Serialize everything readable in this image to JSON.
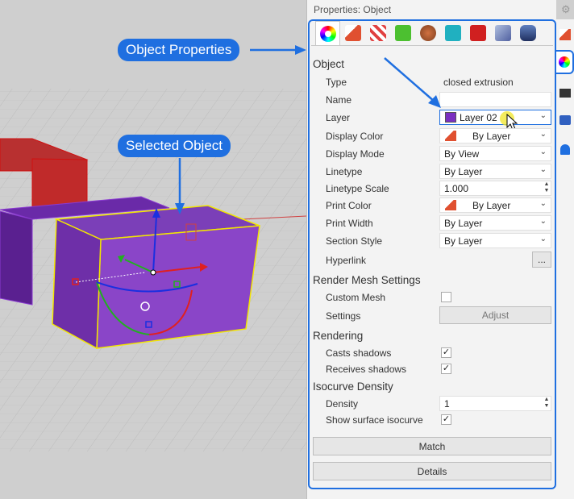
{
  "callouts": {
    "object_properties": "Object Properties",
    "selected_object": "Selected Object"
  },
  "panel": {
    "title": "Properties: Object",
    "tabs": [
      "object-color-wheel-icon",
      "material-brush-icon",
      "decal-icon",
      "texture-mapping-icon",
      "render-mesh-icon",
      "edge-softening-icon",
      "shut-lining-icon",
      "displacement-icon",
      "thickness-icon"
    ],
    "object_section": "Object",
    "type_label": "Type",
    "type_value": "closed extrusion",
    "name_label": "Name",
    "name_value": "",
    "layer_label": "Layer",
    "layer_value": "Layer 02",
    "layer_color": "#7a2fc1",
    "display_color_label": "Display Color",
    "display_color_value": "By Layer",
    "display_mode_label": "Display Mode",
    "display_mode_value": "By View",
    "linetype_label": "Linetype",
    "linetype_value": "By Layer",
    "linetype_scale_label": "Linetype Scale",
    "linetype_scale_value": "1.000",
    "print_color_label": "Print Color",
    "print_color_value": "By Layer",
    "print_width_label": "Print Width",
    "print_width_value": "By Layer",
    "section_style_label": "Section Style",
    "section_style_value": "By Layer",
    "hyperlink_label": "Hyperlink",
    "hyperlink_button": "...",
    "render_mesh_section": "Render Mesh Settings",
    "custom_mesh_label": "Custom Mesh",
    "settings_label": "Settings",
    "adjust_button": "Adjust",
    "rendering_section": "Rendering",
    "casts_shadows_label": "Casts shadows",
    "casts_shadows_checked": true,
    "receives_shadows_label": "Receives shadows",
    "receives_shadows_checked": true,
    "isocurve_section": "Isocurve Density",
    "density_label": "Density",
    "density_value": "1",
    "show_isocurve_label": "Show surface isocurve",
    "show_isocurve_checked": true,
    "match_button": "Match",
    "details_button": "Details"
  },
  "sidetabs": [
    "material-icon",
    "object-properties-icon",
    "display-icon",
    "camera-icon",
    "notification-bell-icon"
  ],
  "colors": {
    "accent": "#1f6fe0",
    "object": "#7a2fc1",
    "selection": "#f2e600"
  },
  "checkmark": "✓",
  "chevron": "⌄",
  "spin_up": "▲",
  "spin_down": "▼",
  "gear_glyph": "⚙"
}
